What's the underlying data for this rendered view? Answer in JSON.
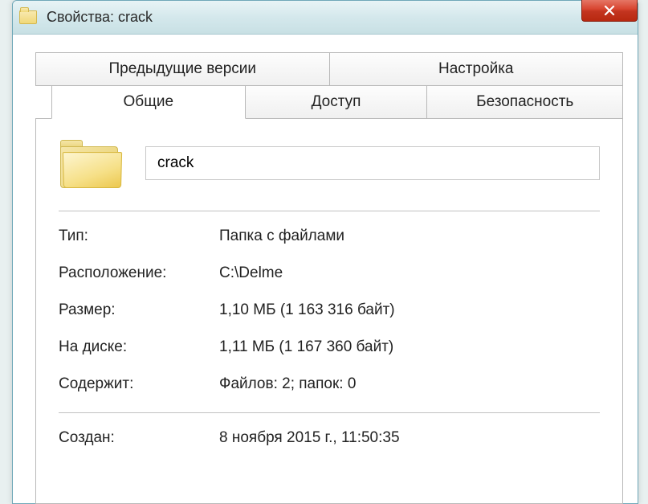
{
  "window": {
    "title": "Свойства: crack"
  },
  "tabs": {
    "row1": {
      "previous_versions": "Предыдущие версии",
      "customize": "Настройка"
    },
    "row2": {
      "general": "Общие",
      "sharing": "Доступ",
      "security": "Безопасность"
    }
  },
  "general": {
    "name": "crack",
    "type_label": "Тип:",
    "type_value": "Папка с файлами",
    "location_label": "Расположение:",
    "location_value": "C:\\Delme",
    "size_label": "Размер:",
    "size_value": "1,10 МБ (1 163 316 байт)",
    "size_on_disk_label": "На диске:",
    "size_on_disk_value": "1,11 МБ (1 167 360 байт)",
    "contains_label": "Содержит:",
    "contains_value": "Файлов: 2; папок: 0",
    "created_label": "Создан:",
    "created_value": "8 ноября 2015 г., 11:50:35"
  }
}
